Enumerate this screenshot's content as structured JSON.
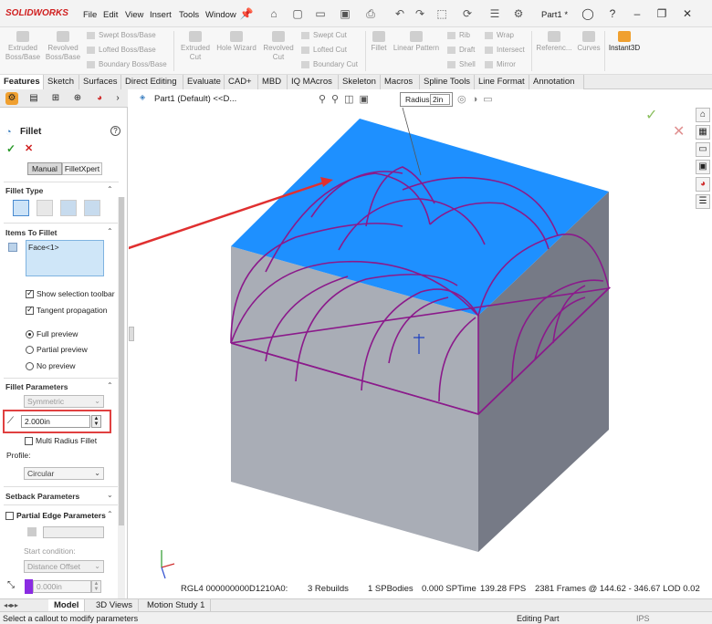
{
  "app": {
    "name": "SOLIDWORKS",
    "menus": [
      "File",
      "Edit",
      "View",
      "Insert",
      "Tools",
      "Window"
    ],
    "document_name": "Part1 *"
  },
  "command_manager": {
    "large": [
      {
        "label": "Extruded Boss/Base",
        "icon": "extrude-boss-icon"
      },
      {
        "label": "Revolved Boss/Base",
        "icon": "revolve-boss-icon"
      },
      {
        "label": "Extruded Cut",
        "icon": "extrude-cut-icon"
      },
      {
        "label": "Hole Wizard",
        "icon": "hole-wizard-icon"
      },
      {
        "label": "Revolved Cut",
        "icon": "revolve-cut-icon"
      },
      {
        "label": "Fillet",
        "icon": "fillet-icon"
      },
      {
        "label": "Linear Pattern",
        "icon": "linear-pattern-icon"
      },
      {
        "label": "Referenc...",
        "icon": "reference-icon"
      },
      {
        "label": "Curves",
        "icon": "curves-icon"
      },
      {
        "label": "Instant3D",
        "icon": "instant3d-icon"
      }
    ],
    "small": [
      "Swept Boss/Base",
      "Lofted Boss/Base",
      "Boundary Boss/Base",
      "Swept Cut",
      "Lofted Cut",
      "Boundary Cut",
      "Rib",
      "Draft",
      "Shell",
      "Wrap",
      "Intersect",
      "Mirror"
    ]
  },
  "tabs": [
    "Features",
    "Sketch",
    "Surfaces",
    "Direct Editing",
    "Evaluate",
    "CAD+",
    "MBD",
    "IQ MAcros",
    "Skeleton",
    "Macros",
    "Spline Tools",
    "Line Format",
    "Annotation"
  ],
  "active_tab": "Features",
  "property_manager": {
    "title": "Fillet",
    "help": "?",
    "ok": "✓",
    "cancel": "✕",
    "mode_tabs": [
      "Manual",
      "FilletXpert"
    ],
    "fillet_type_label": "Fillet Type",
    "items_to_fillet_label": "Items To Fillet",
    "selection": "Face<1>",
    "show_selection_toolbar": "Show selection toolbar",
    "tangent_propagation": "Tangent propagation",
    "preview_options": [
      "Full preview",
      "Partial preview",
      "No preview"
    ],
    "selected_preview": "Full preview",
    "fillet_parameters_label": "Fillet Parameters",
    "symmetric": "Symmetric",
    "radius_value": "2.000in",
    "multi_radius": "Multi Radius Fillet",
    "profile_label": "Profile:",
    "profile_value": "Circular",
    "setback_label": "Setback Parameters",
    "partial_edge_label": "Partial Edge Parameters",
    "start_condition_label": "Start condition:",
    "start_condition_value": "Distance Offset",
    "offset_value": "0.000in"
  },
  "viewport": {
    "tree_label": "Part1 (Default) <<D...",
    "callout_label": "Radius:",
    "callout_value": "2in",
    "top_face_color": "#1e90ff",
    "side_color": "#8a8f9c",
    "preview_color": "#8b1a8b",
    "annotation_color": "#e03030",
    "stats": {
      "graphics": "RGL4 000000000D1210A0:",
      "rebuilds": "3 Rebuilds",
      "bodies": "1 SPBodies",
      "sptime": "0.000 SPTime",
      "fps": "139.28 FPS",
      "frames": "2381 Frames @ 144.62 - 346.67 LOD 0.02"
    }
  },
  "bottom_tabs": [
    "Model",
    "3D Views",
    "Motion Study 1"
  ],
  "status": {
    "message": "Select a callout to modify parameters",
    "mode": "Editing Part",
    "units": "IPS"
  }
}
